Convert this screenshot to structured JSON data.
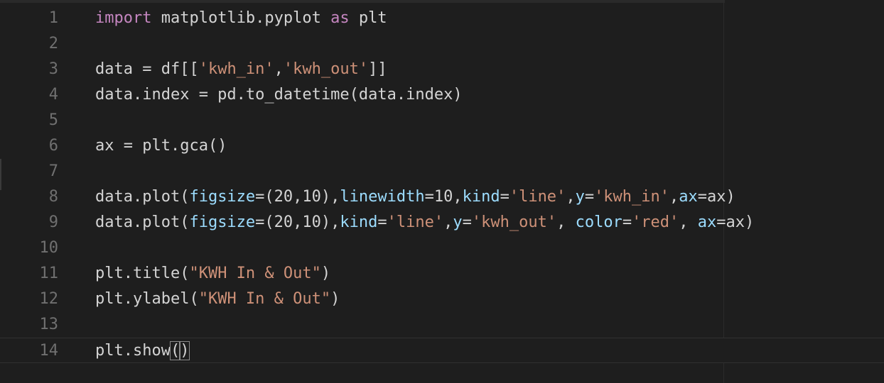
{
  "editor": {
    "lines": [
      {
        "number": "1",
        "tokens": [
          {
            "t": "import",
            "c": "kw"
          },
          {
            "t": " matplotlib.pyplot ",
            "c": ""
          },
          {
            "t": "as",
            "c": "kw"
          },
          {
            "t": " plt",
            "c": ""
          }
        ]
      },
      {
        "number": "2",
        "tokens": []
      },
      {
        "number": "3",
        "tokens": [
          {
            "t": "data = df[[",
            "c": ""
          },
          {
            "t": "'kwh_in'",
            "c": "str"
          },
          {
            "t": ",",
            "c": ""
          },
          {
            "t": "'kwh_out'",
            "c": "str"
          },
          {
            "t": "]]",
            "c": ""
          }
        ]
      },
      {
        "number": "4",
        "tokens": [
          {
            "t": "data.index = pd.to_datetime(data.index)",
            "c": ""
          }
        ]
      },
      {
        "number": "5",
        "tokens": []
      },
      {
        "number": "6",
        "tokens": [
          {
            "t": "ax = plt.gca()",
            "c": ""
          }
        ]
      },
      {
        "number": "7",
        "tokens": []
      },
      {
        "number": "8",
        "tokens": [
          {
            "t": "data.plot(",
            "c": ""
          },
          {
            "t": "figsize",
            "c": "param"
          },
          {
            "t": "=(20,10),",
            "c": ""
          },
          {
            "t": "linewidth",
            "c": "param"
          },
          {
            "t": "=10,",
            "c": ""
          },
          {
            "t": "kind",
            "c": "param"
          },
          {
            "t": "=",
            "c": ""
          },
          {
            "t": "'line'",
            "c": "str"
          },
          {
            "t": ",",
            "c": ""
          },
          {
            "t": "y",
            "c": "param"
          },
          {
            "t": "=",
            "c": ""
          },
          {
            "t": "'kwh_in'",
            "c": "str"
          },
          {
            "t": ",",
            "c": ""
          },
          {
            "t": "ax",
            "c": "param"
          },
          {
            "t": "=ax)",
            "c": ""
          }
        ]
      },
      {
        "number": "9",
        "tokens": [
          {
            "t": "data.plot(",
            "c": ""
          },
          {
            "t": "figsize",
            "c": "param"
          },
          {
            "t": "=(20,10),",
            "c": ""
          },
          {
            "t": "kind",
            "c": "param"
          },
          {
            "t": "=",
            "c": ""
          },
          {
            "t": "'line'",
            "c": "str"
          },
          {
            "t": ",",
            "c": ""
          },
          {
            "t": "y",
            "c": "param"
          },
          {
            "t": "=",
            "c": ""
          },
          {
            "t": "'kwh_out'",
            "c": "str"
          },
          {
            "t": ", ",
            "c": ""
          },
          {
            "t": "color",
            "c": "param"
          },
          {
            "t": "=",
            "c": ""
          },
          {
            "t": "'red'",
            "c": "str"
          },
          {
            "t": ", ",
            "c": ""
          },
          {
            "t": "ax",
            "c": "param"
          },
          {
            "t": "=ax)",
            "c": ""
          }
        ]
      },
      {
        "number": "10",
        "tokens": []
      },
      {
        "number": "11",
        "tokens": [
          {
            "t": "plt.title(",
            "c": ""
          },
          {
            "t": "\"KWH In & Out\"",
            "c": "str"
          },
          {
            "t": ")",
            "c": ""
          }
        ]
      },
      {
        "number": "12",
        "tokens": [
          {
            "t": "plt.ylabel(",
            "c": ""
          },
          {
            "t": "\"KWH In & Out\"",
            "c": "str"
          },
          {
            "t": ")",
            "c": ""
          }
        ]
      },
      {
        "number": "13",
        "tokens": []
      },
      {
        "number": "14",
        "tokens": [
          {
            "t": "plt.show",
            "c": ""
          },
          {
            "t": "(",
            "c": "bm"
          },
          {
            "t": "",
            "c": "cursor"
          },
          {
            "t": ")",
            "c": "bm"
          }
        ],
        "current": true
      }
    ]
  },
  "colors": {
    "background": "#1e1e1e",
    "text": "#d4d4d4",
    "keyword": "#c586c0",
    "string": "#ce9178",
    "parameter": "#9cdcfe",
    "line_number": "#707070"
  }
}
